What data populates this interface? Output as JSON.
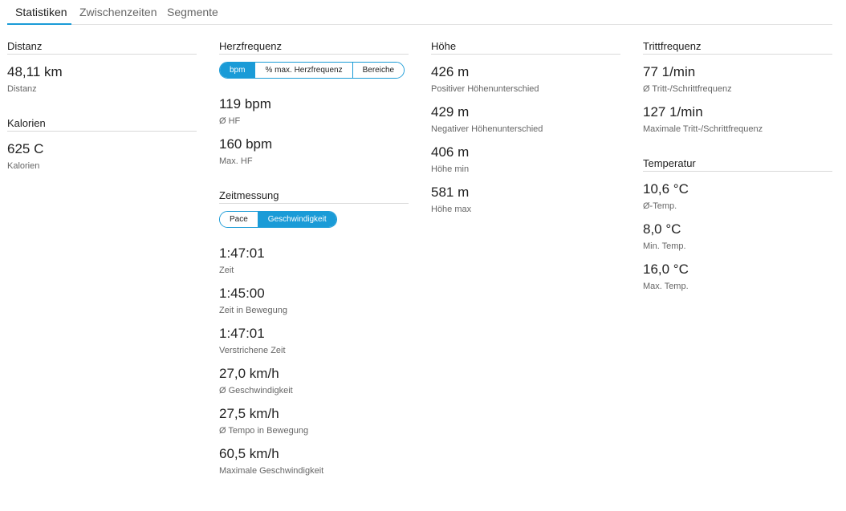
{
  "tabs": [
    "Statistiken",
    "Zwischenzeiten",
    "Segmente"
  ],
  "accent_color": "#1a9bd7",
  "columns": {
    "col1": [
      {
        "title": "Distanz",
        "stats": [
          {
            "value": "48,11 km",
            "label": "Distanz"
          }
        ]
      },
      {
        "title": "Kalorien",
        "stats": [
          {
            "value": "625 C",
            "label": "Kalorien"
          }
        ]
      }
    ],
    "col2": {
      "hr": {
        "title": "Herzfrequenz",
        "toggle": [
          "bpm",
          "% max. Herzfrequenz",
          "Bereiche"
        ],
        "selected": "bpm",
        "stats": [
          {
            "value": "119 bpm",
            "label": "Ø HF"
          },
          {
            "value": "160 bpm",
            "label": "Max. HF"
          }
        ]
      },
      "timing": {
        "title": "Zeitmessung",
        "toggle": [
          "Pace",
          "Geschwindigkeit"
        ],
        "selected": "Geschwindigkeit",
        "stats": [
          {
            "value": "1:47:01",
            "label": "Zeit"
          },
          {
            "value": "1:45:00",
            "label": "Zeit in Bewegung"
          },
          {
            "value": "1:47:01",
            "label": "Verstrichene Zeit"
          },
          {
            "value": "27,0 km/h",
            "label": "Ø Geschwindigkeit"
          },
          {
            "value": "27,5 km/h",
            "label": "Ø Tempo in Bewegung"
          },
          {
            "value": "60,5 km/h",
            "label": "Maximale Geschwindigkeit"
          }
        ]
      }
    },
    "col3": [
      {
        "title": "Höhe",
        "stats": [
          {
            "value": "426 m",
            "label": "Positiver Höhenunterschied"
          },
          {
            "value": "429 m",
            "label": "Negativer Höhenunterschied"
          },
          {
            "value": "406 m",
            "label": "Höhe min"
          },
          {
            "value": "581 m",
            "label": "Höhe max"
          }
        ]
      }
    ],
    "col4": [
      {
        "title": "Trittfrequenz",
        "stats": [
          {
            "value": "77 1/min",
            "label": "Ø Tritt-/Schrittfrequenz"
          },
          {
            "value": "127 1/min",
            "label": "Maximale Tritt-/Schrittfrequenz"
          }
        ]
      },
      {
        "title": "Temperatur",
        "stats": [
          {
            "value": "10,6 °C",
            "label": "Ø-Temp."
          },
          {
            "value": "8,0 °C",
            "label": "Min. Temp."
          },
          {
            "value": "16,0 °C",
            "label": "Max. Temp."
          }
        ]
      }
    ]
  }
}
